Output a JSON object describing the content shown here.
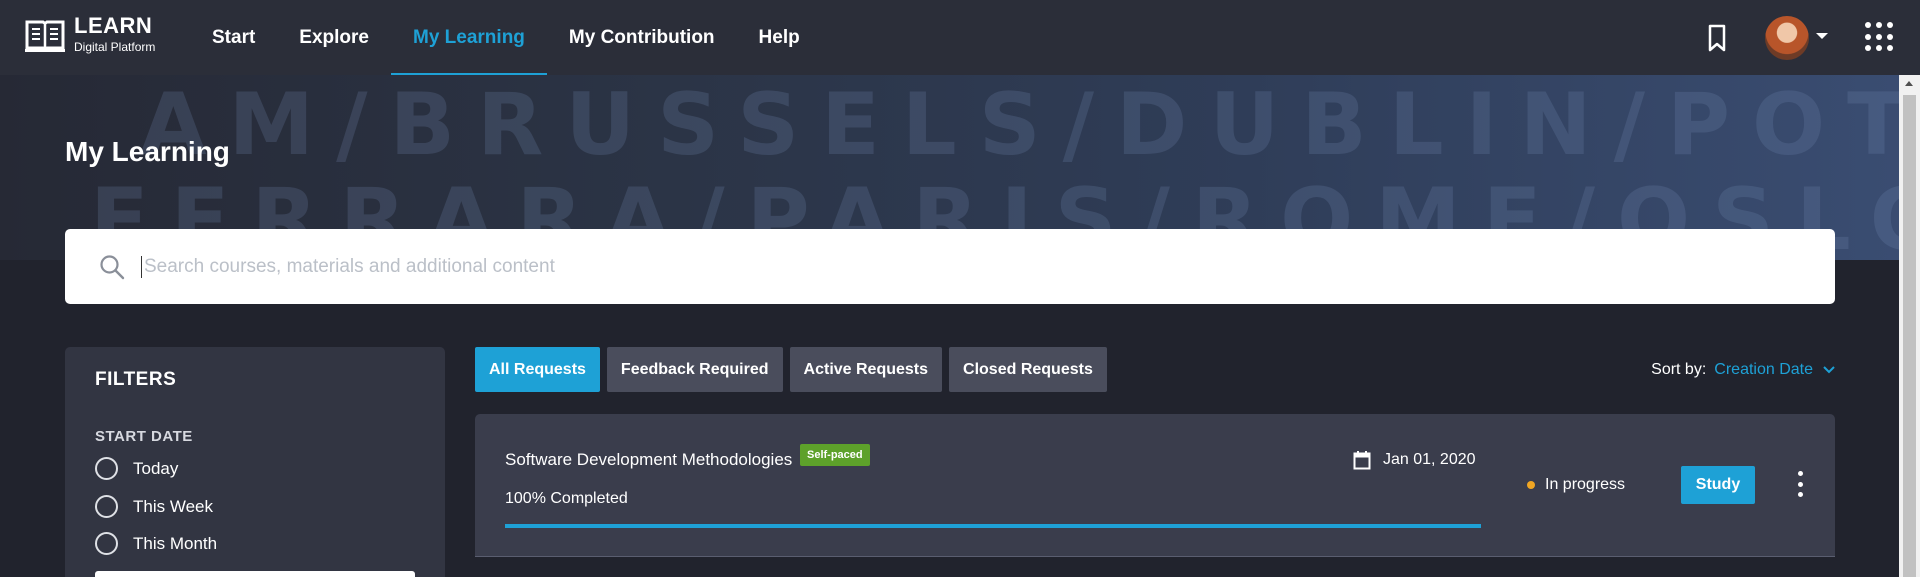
{
  "brand": {
    "title": "LEARN",
    "subtitle": "Digital Platform"
  },
  "nav": {
    "items": [
      {
        "label": "Start"
      },
      {
        "label": "Explore"
      },
      {
        "label": "My Learning"
      },
      {
        "label": "My Contribution"
      },
      {
        "label": "Help"
      }
    ],
    "active": "My Learning"
  },
  "hero": {
    "row1": "AM/BRUSSELS/DUBLIN/POTSDAM/BR",
    "row2": "FERRARA/PARIS/ROME/OSLO/FERRAR"
  },
  "page": {
    "title": "My Learning"
  },
  "search": {
    "placeholder": "Search courses, materials and additional content",
    "value": ""
  },
  "filters": {
    "title": "FILTERS",
    "groups": [
      {
        "title": "START DATE",
        "options": [
          "Today",
          "This Week",
          "This Month"
        ]
      }
    ]
  },
  "tabs": [
    {
      "label": "All Requests"
    },
    {
      "label": "Feedback Required"
    },
    {
      "label": "Active Requests"
    },
    {
      "label": "Closed Requests"
    }
  ],
  "active_tab": "All Requests",
  "sort": {
    "label": "Sort by:",
    "value": "Creation Date"
  },
  "requests": [
    {
      "title": "Software Development Methodologies",
      "badge": "Self-paced",
      "date": "Jan 01, 2020",
      "progress_text": "100% Completed",
      "progress": 1.0,
      "status": "In progress",
      "action": "Study"
    }
  ],
  "colors": {
    "accent": "#1ea1d6",
    "badge_green": "#5da12a",
    "status_in_progress": "#f0a623",
    "background": "#21232d",
    "topbar": "#2b2e39",
    "card": "#3a3d4c"
  },
  "icons": [
    "book-icon",
    "bookmark-icon",
    "apps-grid-icon",
    "search-icon",
    "calendar-icon",
    "chevron-down-icon",
    "kebab-menu-icon"
  ]
}
